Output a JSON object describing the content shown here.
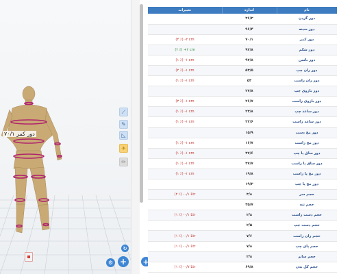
{
  "viewer": {
    "measure_label": "دور کمر ۷۰/۱"
  },
  "table": {
    "headers": {
      "changes": "تغییرات",
      "value": "اندازه",
      "name": "نام"
    },
    "rows": [
      {
        "name": "دور گردن",
        "value": "۳۶/۳",
        "change": "",
        "tone": "neutral"
      },
      {
        "name": "دور سینه",
        "value": "۹۶/۴",
        "change": "",
        "tone": "neutral"
      },
      {
        "name": "دور کمر",
        "value": "۷۰/۱",
        "change": "(۴ ٪) -۲ cm",
        "tone": "red"
      },
      {
        "name": "دور شکم",
        "value": "۹۲/۸",
        "change": "(۲ ٪) +۲ cm",
        "tone": "green"
      },
      {
        "name": "دور باسن",
        "value": "۹۲/۸",
        "change": "(۱ ٪) -۱ cm",
        "tone": "red"
      },
      {
        "name": "دور ران چپ",
        "value": "۵۳/۵",
        "change": "(۲ ٪) -۱ cm",
        "tone": "red"
      },
      {
        "name": "دور ران راست",
        "value": "۵۳",
        "change": "(۱ ٪) -۱ cm",
        "tone": "red"
      },
      {
        "name": "دور بازوی چپ",
        "value": "۲۷/۸",
        "change": "",
        "tone": "neutral"
      },
      {
        "name": "دور بازوی راست",
        "value": "۲۶/۷",
        "change": "(۳ ٪) -۱ cm",
        "tone": "red"
      },
      {
        "name": "دور ساعد چپ",
        "value": "۲۳/۸",
        "change": "(۱ ٪) -۱ cm",
        "tone": "red"
      },
      {
        "name": "دور ساعد راست",
        "value": "۲۲/۶",
        "change": "(۱ ٪) -۱ cm",
        "tone": "red"
      },
      {
        "name": "دور مچ دست",
        "value": "۱۵/۹",
        "change": "",
        "tone": "neutral"
      },
      {
        "name": "دور مچ راست",
        "value": "۱۶/۷",
        "change": "(۱ ٪) -۱ cm",
        "tone": "red"
      },
      {
        "name": "دور ساق پا چپ",
        "value": "۳۷/۶",
        "change": "(۱ ٪) -۱ cm",
        "tone": "red"
      },
      {
        "name": "دور ساق پا راست",
        "value": "۳۷/۷",
        "change": "(۱ ٪) -۱ cm",
        "tone": "red"
      },
      {
        "name": "دور مچ پا راست",
        "value": "۱۹/۸",
        "change": "(۱ ٪) -۱ cm",
        "tone": "red"
      },
      {
        "name": "دور مچ پا چپ",
        "value": "۱۹/۳",
        "change": "",
        "tone": "neutral"
      },
      {
        "name": "حجم سر",
        "value": "۳/۸",
        "change": "(۲ ٪) -۰/۱ Ltr",
        "tone": "red"
      },
      {
        "name": "حجم تنه",
        "value": "۳۵/۷",
        "change": "",
        "tone": "neutral"
      },
      {
        "name": "حجم دست راست",
        "value": "۲/۸",
        "change": "(۱ ٪) -۰/۱ Ltr",
        "tone": "red"
      },
      {
        "name": "حجم دست چپ",
        "value": "۲/۵",
        "change": "",
        "tone": "neutral"
      },
      {
        "name": "حجم ران راست",
        "value": "۷/۶",
        "change": "(۱ ٪) -۰/۱ Ltr",
        "tone": "red"
      },
      {
        "name": "حجم پای چپ",
        "value": "۷/۸",
        "change": "(۱ ٪) -۰/۱ Ltr",
        "tone": "red"
      },
      {
        "name": "حجم سایر",
        "value": "۲/۸",
        "change": "",
        "tone": "neutral"
      },
      {
        "name": "حجم کل بدن",
        "value": "۶۹/۸",
        "change": "(۱ ٪) -۰/۷ Ltr",
        "tone": "red"
      }
    ]
  },
  "colors": {
    "header_bg": "#3d7cc0",
    "accent": "#3f86d4",
    "negative": "#c6302a",
    "positive": "#2e8b3a"
  },
  "icons": {
    "tools": [
      "ruler-icon",
      "measure-tape-icon",
      "ruler-angle-icon",
      "sun-icon",
      "pencil-icon"
    ],
    "fabs": [
      "settings-fab",
      "add-fab",
      "add-table-fab",
      "small-round-fab"
    ]
  }
}
